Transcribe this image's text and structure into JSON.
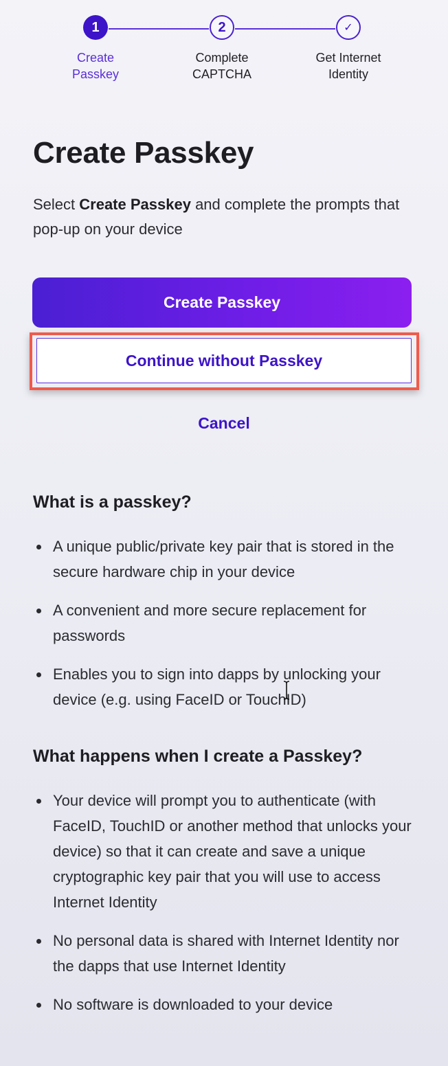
{
  "stepper": {
    "steps": [
      {
        "number": "1",
        "label_line1": "Create",
        "label_line2": "Passkey",
        "state": "active"
      },
      {
        "number": "2",
        "label_line1": "Complete",
        "label_line2": "CAPTCHA",
        "state": "pending"
      },
      {
        "number": "✓",
        "label_line1": "Get Internet",
        "label_line2": "Identity",
        "state": "pending"
      }
    ]
  },
  "header": {
    "title": "Create Passkey",
    "intro_prefix": "Select ",
    "intro_bold": "Create Passkey",
    "intro_suffix": " and complete the prompts that pop-up on your device"
  },
  "actions": {
    "create_label": "Create Passkey",
    "continue_label": "Continue without Passkey",
    "cancel_label": "Cancel"
  },
  "faq": {
    "what_title": "What is a passkey?",
    "what_items": [
      "A unique public/private key pair that is stored in the secure hardware chip in your device",
      "A convenient and more secure replacement for passwords",
      "Enables you to sign into dapps by unlocking your device (e.g. using FaceID or TouchID)"
    ],
    "happens_title": "What happens when I create a Passkey?",
    "happens_items": [
      "Your device will prompt you to authenticate (with FaceID, TouchID or another method that unlocks your device) so that it can create and save a unique cryptographic key pair that you will use to access Internet Identity",
      "No personal data is shared with Internet Identity nor the dapps that use Internet Identity",
      "No software is downloaded to your device"
    ]
  },
  "colors": {
    "accent": "#3d14c8",
    "highlight": "#f05a4a"
  },
  "icons": {
    "cursor": "text-cursor-icon",
    "check": "check-icon"
  }
}
